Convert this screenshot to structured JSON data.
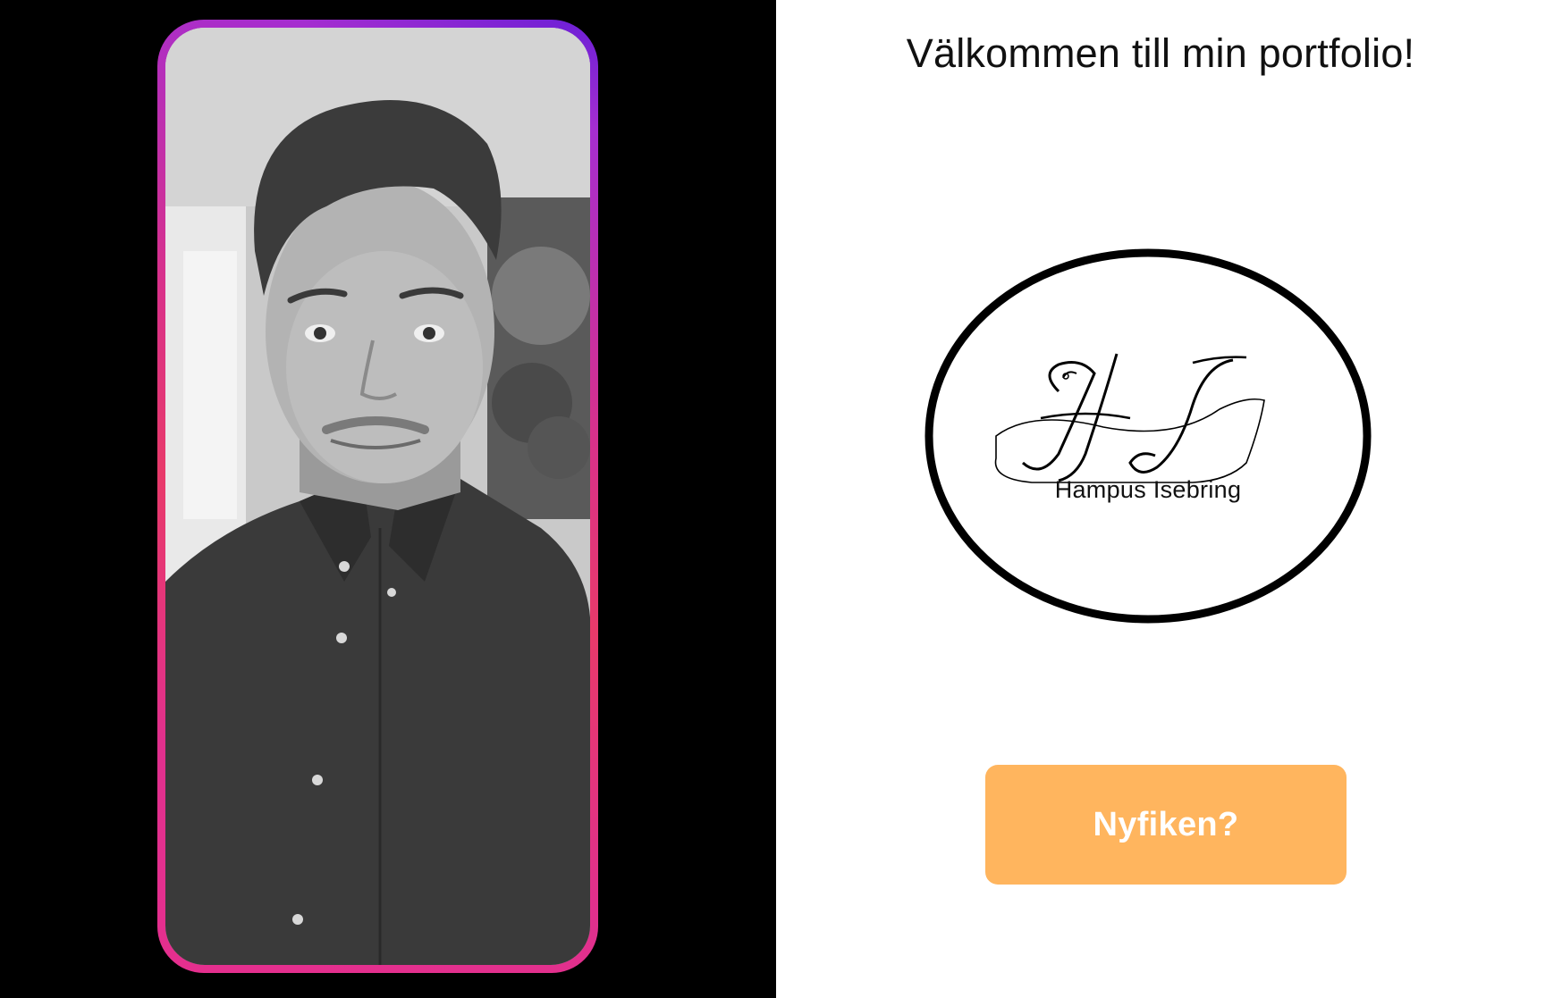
{
  "hero": {
    "title": "Välkommen till min portfolio!"
  },
  "profile_photo": {
    "alt": "portrait-photo",
    "frame_colors": [
      "#6a1fd6",
      "#d9318a",
      "#e52f8e"
    ]
  },
  "logo": {
    "monogram": "HI",
    "name": "Hampus Isebring"
  },
  "cta": {
    "label": "Nyfiken?",
    "color": "#ffb55e"
  },
  "colors": {
    "left_background": "#000000",
    "right_background": "#ffffff"
  }
}
